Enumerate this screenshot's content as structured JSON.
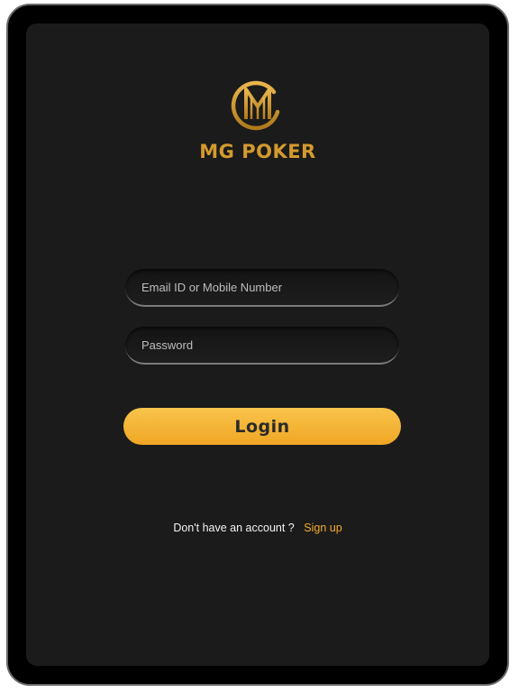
{
  "app": {
    "brand_name": "MG POKER",
    "logo_icon": "mg-monogram-logo-icon"
  },
  "login_form": {
    "email_placeholder": "Email ID or Mobile Number",
    "password_placeholder": "Password",
    "login_label": "Login"
  },
  "signup": {
    "prompt": "Don't have an account ?",
    "link_label": "Sign up"
  },
  "colors": {
    "accent": "#f4ab2a",
    "brand_gold": "#d49a2e",
    "background": "#1b1b1b"
  }
}
